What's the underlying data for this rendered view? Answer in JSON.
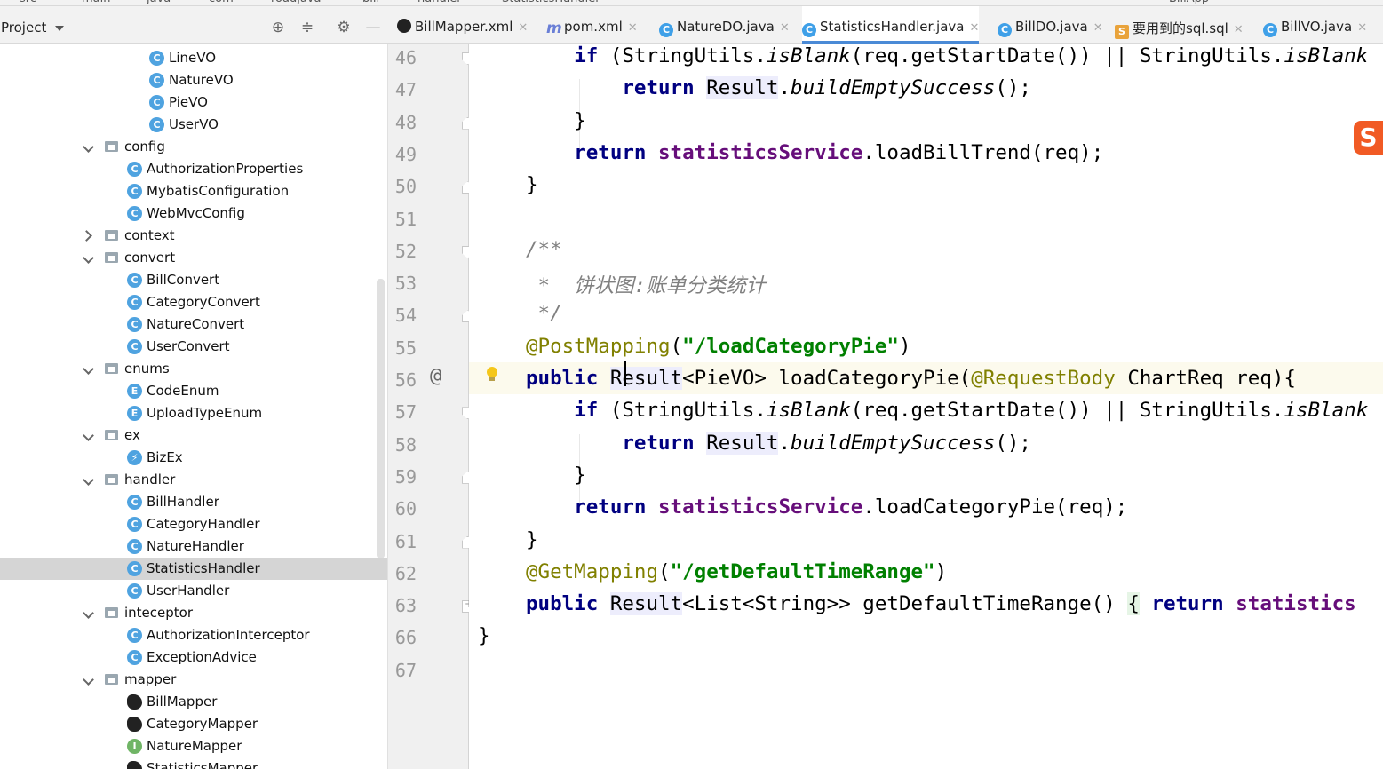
{
  "breadcrumb": [
    "src",
    "main",
    "java",
    "com",
    "roadjava",
    "bill",
    "handler",
    "StatisticsHandler"
  ],
  "run_config": "BillApp",
  "project_panel": {
    "title": "Project"
  },
  "tabs": [
    {
      "label": "BillMapper.xml",
      "icon": "bird-icon"
    },
    {
      "label": "pom.xml",
      "icon": "maven-icon"
    },
    {
      "label": "NatureDO.java",
      "icon": "class-icon"
    },
    {
      "label": "StatisticsHandler.java",
      "icon": "class-icon",
      "active": true
    },
    {
      "label": "BillDO.java",
      "icon": "class-icon"
    },
    {
      "label": "要用到的sql.sql",
      "icon": "sql-icon"
    },
    {
      "label": "BillVO.java",
      "icon": "class-icon"
    }
  ],
  "tree": [
    {
      "label": "LineVO",
      "type": "class",
      "depth": 2
    },
    {
      "label": "NatureVO",
      "type": "class",
      "depth": 2
    },
    {
      "label": "PieVO",
      "type": "class",
      "depth": 2
    },
    {
      "label": "UserVO",
      "type": "class",
      "depth": 2
    },
    {
      "label": "config",
      "type": "folder",
      "state": "open",
      "depth": 1
    },
    {
      "label": "AuthorizationProperties",
      "type": "class",
      "depth": 2
    },
    {
      "label": "MybatisConfiguration",
      "type": "class",
      "depth": 2
    },
    {
      "label": "WebMvcConfig",
      "type": "class",
      "depth": 2
    },
    {
      "label": "context",
      "type": "folder",
      "state": "closed",
      "depth": 1
    },
    {
      "label": "convert",
      "type": "folder",
      "state": "open",
      "depth": 1
    },
    {
      "label": "BillConvert",
      "type": "class",
      "depth": 2
    },
    {
      "label": "CategoryConvert",
      "type": "class",
      "depth": 2
    },
    {
      "label": "NatureConvert",
      "type": "class",
      "depth": 2
    },
    {
      "label": "UserConvert",
      "type": "class",
      "depth": 2
    },
    {
      "label": "enums",
      "type": "folder",
      "state": "open",
      "depth": 1
    },
    {
      "label": "CodeEnum",
      "type": "enum",
      "depth": 2
    },
    {
      "label": "UploadTypeEnum",
      "type": "enum",
      "depth": 2
    },
    {
      "label": "ex",
      "type": "folder",
      "state": "open",
      "depth": 1
    },
    {
      "label": "BizEx",
      "type": "exception",
      "depth": 2
    },
    {
      "label": "handler",
      "type": "folder",
      "state": "open",
      "depth": 1
    },
    {
      "label": "BillHandler",
      "type": "class",
      "depth": 2
    },
    {
      "label": "CategoryHandler",
      "type": "class",
      "depth": 2
    },
    {
      "label": "NatureHandler",
      "type": "class",
      "depth": 2
    },
    {
      "label": "StatisticsHandler",
      "type": "class",
      "depth": 2,
      "selected": true
    },
    {
      "label": "UserHandler",
      "type": "class",
      "depth": 2
    },
    {
      "label": "inteceptor",
      "type": "folder",
      "state": "open",
      "depth": 1
    },
    {
      "label": "AuthorizationInterceptor",
      "type": "class",
      "depth": 2
    },
    {
      "label": "ExceptionAdvice",
      "type": "class",
      "depth": 2
    },
    {
      "label": "mapper",
      "type": "folder",
      "state": "open",
      "depth": 1
    },
    {
      "label": "BillMapper",
      "type": "mybatis",
      "depth": 2
    },
    {
      "label": "CategoryMapper",
      "type": "mybatis",
      "depth": 2
    },
    {
      "label": "NatureMapper",
      "type": "interface",
      "depth": 2
    },
    {
      "label": "StatisticsMapper",
      "type": "mybatis",
      "depth": 2
    }
  ],
  "line_numbers": [
    "46",
    "47",
    "48",
    "49",
    "50",
    "51",
    "52",
    "53",
    "54",
    "55",
    "56",
    "57",
    "58",
    "59",
    "60",
    "61",
    "62",
    "63",
    "66",
    "67"
  ],
  "code_lines": [
    [
      {
        "t": "    "
      },
      {
        "t": "if",
        "c": "kw"
      },
      {
        "t": " (StringUtils."
      },
      {
        "t": "isBlank",
        "c": "it"
      },
      {
        "t": "(req.getStartDate()) || StringUtils."
      },
      {
        "t": "isBlank",
        "c": "it"
      }
    ],
    [
      {
        "t": "        "
      },
      {
        "t": "return",
        "c": "kw"
      },
      {
        "t": " "
      },
      {
        "t": "Result",
        "c": "rhl"
      },
      {
        "t": "."
      },
      {
        "t": "buildEmptySuccess",
        "c": "it"
      },
      {
        "t": "();"
      }
    ],
    [
      {
        "t": "    }"
      }
    ],
    [
      {
        "t": "    "
      },
      {
        "t": "return",
        "c": "kw"
      },
      {
        "t": " "
      },
      {
        "t": "statisticsService",
        "c": "fld"
      },
      {
        "t": ".loadBillTrend(req);"
      }
    ],
    [
      {
        "t": "}"
      }
    ],
    [
      {
        "t": ""
      }
    ],
    [
      {
        "t": "/**",
        "c": "cmt"
      }
    ],
    [
      {
        "t": " *  饼状图:账单分类统计",
        "c": "cmt"
      }
    ],
    [
      {
        "t": " */",
        "c": "cmt"
      }
    ],
    [
      {
        "t": "@PostMapping",
        "c": "ann"
      },
      {
        "t": "("
      },
      {
        "t": "\"/loadCategoryPie\"",
        "c": "str"
      },
      {
        "t": ")"
      }
    ],
    [
      {
        "t": "public",
        "c": "kw"
      },
      {
        "t": " "
      },
      {
        "t": "Result",
        "c": "rhl"
      },
      {
        "t": "<PieVO> loadCategoryPie("
      },
      {
        "t": "@RequestBody",
        "c": "ann"
      },
      {
        "t": " ChartReq req){"
      }
    ],
    [
      {
        "t": "    "
      },
      {
        "t": "if",
        "c": "kw"
      },
      {
        "t": " (StringUtils."
      },
      {
        "t": "isBlank",
        "c": "it"
      },
      {
        "t": "(req.getStartDate()) || StringUtils."
      },
      {
        "t": "isBlank",
        "c": "it"
      }
    ],
    [
      {
        "t": "        "
      },
      {
        "t": "return",
        "c": "kw"
      },
      {
        "t": " "
      },
      {
        "t": "Result",
        "c": "rhl"
      },
      {
        "t": "."
      },
      {
        "t": "buildEmptySuccess",
        "c": "it"
      },
      {
        "t": "();"
      }
    ],
    [
      {
        "t": "    }"
      }
    ],
    [
      {
        "t": "    "
      },
      {
        "t": "return",
        "c": "kw"
      },
      {
        "t": " "
      },
      {
        "t": "statisticsService",
        "c": "fld"
      },
      {
        "t": ".loadCategoryPie(req);"
      }
    ],
    [
      {
        "t": "}"
      }
    ],
    [
      {
        "t": "@GetMapping",
        "c": "ann"
      },
      {
        "t": "("
      },
      {
        "t": "\"/getDefaultTimeRange\"",
        "c": "str"
      },
      {
        "t": ")"
      }
    ],
    [
      {
        "t": "public",
        "c": "kw"
      },
      {
        "t": " "
      },
      {
        "t": "Result",
        "c": "rhl"
      },
      {
        "t": "<List<String>> getDefaultTimeRange() "
      },
      {
        "t": "{",
        "c": "bhl"
      },
      {
        "t": " "
      },
      {
        "t": "return",
        "c": "kw"
      },
      {
        "t": " "
      },
      {
        "t": "statistics",
        "c": "fld"
      }
    ],
    [
      {
        "t": "}"
      }
    ],
    [
      {
        "t": ""
      }
    ]
  ],
  "colors": {
    "keyword": "#000080",
    "field": "#660e7a",
    "string": "#008000",
    "annotation": "#808000",
    "comment": "#808080",
    "selection": "#d5d5d5",
    "current_line": "#fcfaed"
  },
  "ime_badge": "S"
}
